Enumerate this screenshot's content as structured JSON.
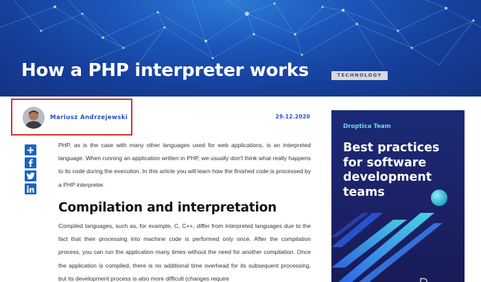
{
  "hero": {
    "title": "How a PHP interpreter works",
    "tag": "TECHNOLOGY"
  },
  "author": {
    "name": "Mariusz Andrzejewski",
    "date": "29.12.2020"
  },
  "share": [
    {
      "name": "share-plus-icon",
      "glyph": "+"
    },
    {
      "name": "facebook-icon",
      "glyph": "f"
    },
    {
      "name": "twitter-icon",
      "glyph": "t"
    },
    {
      "name": "linkedin-icon",
      "glyph": "in"
    }
  ],
  "article": {
    "intro": "PHP, as is the case with many other languages used for web applications, is an interpreted language. When running an application written in PHP, we usually don't think what really happens to its code during the execution. In this article you will learn how the finished code is processed by a PHP interpreter.",
    "heading": "Compilation and interpretation",
    "paragraph": "Compiled languages, such as, for example, C, C++, differ from interpreted languages due to the fact that their processing into machine code is performed only once. After the compilation process, you can run the application many times without the need for another compilation. Once the application is compiled, there is no additional time overhead for its subsequent processing, but its development process is also more difficult (changes require"
  },
  "ad": {
    "brand": "Droptica Team",
    "headline": "Best practices for software development teams"
  },
  "colors": {
    "accent": "#1f4ecf",
    "share": "#1a64c4",
    "hero": "#1b55b8",
    "ad_bg": "#1c2369",
    "highlight": "#d42d2d"
  }
}
